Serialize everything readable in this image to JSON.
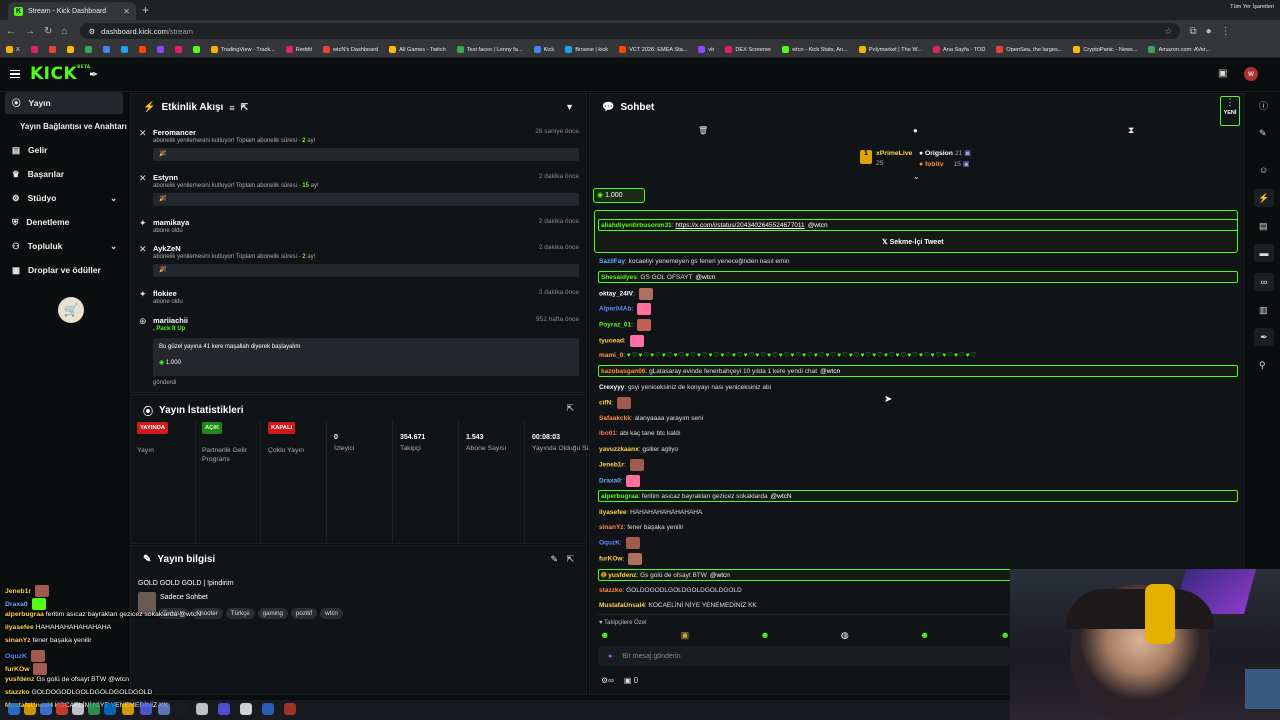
{
  "browser": {
    "tab_title": "Stream - Kick Dashboard",
    "url_host": "dashboard.kick.com",
    "url_path": "/stream",
    "bookmarks": [
      "X",
      "",
      "",
      "",
      "",
      "",
      "",
      "",
      "",
      "",
      "",
      "TradingView - Track...",
      "Reddit",
      "wtcN's Dashboard",
      "All Games - Twitch",
      "Text faces | Lenny fa...",
      "Kick",
      "Browse | kick",
      "VCT 2026: EMEA Sta...",
      "vlr",
      "DEX Screener",
      "wtcn - Kick Stats, An...",
      "Polymarket | The W...",
      "Ana Sayfa - TOD",
      "OpenSea, the larges...",
      "CryptoPanic - News...",
      "Amazon.com: AVer..."
    ],
    "bookmarks_all": "Tüm Yer İşaretleri"
  },
  "sidebar": {
    "items": [
      {
        "label": "Yayın"
      },
      {
        "label": "Yayın Bağlantısı ve Anahtarı"
      },
      {
        "label": "Gelir"
      },
      {
        "label": "Başarılar"
      },
      {
        "label": "Stüdyo"
      },
      {
        "label": "Denetleme"
      },
      {
        "label": "Topluluk"
      },
      {
        "label": "Droplar ve ödüller"
      }
    ]
  },
  "activity": {
    "title": "Etkinlik Akışı",
    "items": [
      {
        "name": "Feromancer",
        "time": "28 saniye önce",
        "desc_a": "abonelik yenilemesini kutluyor! Toplam abonelik süresi - ",
        "desc_b": "2",
        "desc_c": " ay!"
      },
      {
        "name": "Estynn",
        "time": "2 dakika önce",
        "desc_a": "abonelik yenilemesini kutluyor! Toplam abonelik süresi - ",
        "desc_b": "15",
        "desc_c": " ay!"
      },
      {
        "name": "mamikaya",
        "time": "2 dakika önce",
        "desc": "abone oldu"
      },
      {
        "name": "AykZeN",
        "time": "2 dakika önce",
        "desc_a": "abonelik yenilemesini kutluyor! Toplam abonelik süresi - ",
        "desc_b": "2",
        "desc_c": " ay!"
      },
      {
        "name": "flokiee",
        "time": "3 dakika önce",
        "desc": "abone oldu"
      },
      {
        "name": "mariiachii",
        "time": "952 hafta önce",
        "pack": ", Pack It Up",
        "msg": "Bu güzel yayına 41 kere maşallah diyerek başlayalım",
        "amount": "1.000",
        "sent": "gönderdi"
      }
    ]
  },
  "stats": {
    "title": "Yayın İstatistikleri",
    "cols": [
      {
        "badge": "YAYINDA",
        "label": "Yayın"
      },
      {
        "badge": "AÇIK",
        "label": "Partnerlik Gelir Programı"
      },
      {
        "badge": "KAPALI",
        "label": "Çoklu Yayın"
      },
      {
        "value": "0",
        "label": "İzleyici"
      },
      {
        "value": "354.671",
        "label": "Takipçi"
      },
      {
        "value": "1.543",
        "label": "Abone Sayısı"
      },
      {
        "value": "00:08:03",
        "label": "Yayında Olduğu Süre"
      }
    ]
  },
  "info": {
    "title": "Yayın bilgisi",
    "stream_title": "GOLD GOLD GOLD | !pindirim",
    "chat_mode": "Sadece Sohbet",
    "tags": [
      "Turkish",
      "Shooter",
      "Türkçe",
      "gaming",
      "pozitif",
      "wtcn"
    ]
  },
  "chat": {
    "title": "Sohbet",
    "new_label": "YENİ",
    "leader1": {
      "name": "xPrimeLive",
      "count": "25"
    },
    "leader2": {
      "name": "Origsion",
      "count": "21"
    },
    "leader3": {
      "name": "fobitv",
      "count": "15"
    },
    "kicks": "1.000",
    "tweet_label": "Sekme-İçi Tweet",
    "messages": [
      {
        "user": "aliahdiyentirbusonm31",
        "text": "https://x.com/i/status/2043402645524677011",
        "mention": "@wtcn",
        "color": "#53fc18"
      },
      {
        "user": "SazilFay",
        "text": "kocaeliyi yenemeyen gs feneri yeneceğinden nasıl emin",
        "color": "#6ea8ff"
      },
      {
        "user": "Shesaidyes",
        "text": "GS GOL OFSAYT",
        "mention": "@wtcn",
        "color": "#53fc18"
      },
      {
        "user": "oktay_24IV",
        "text": "",
        "color": "#ffffff"
      },
      {
        "user": "Alper04Ab",
        "text": "",
        "color": "#5b8cff"
      },
      {
        "user": "Poyraz_01",
        "text": "",
        "color": "#53fc18"
      },
      {
        "user": "tyuoead",
        "text": "",
        "color": "#ffd24a"
      },
      {
        "user": "mami_0",
        "text": "",
        "color": "#ff9b3b"
      },
      {
        "user": "kazobasgan06",
        "text": "gLatasaray evinde fenerbahçeyi 10 yılda 1 kere yendi chat",
        "mention": "@wtcn",
        "color": "#ff8a3b"
      },
      {
        "user": "Crexyyy",
        "text": "gsyi yeniceksiniz de konyayı nası yeniceksiniz abi",
        "color": "#ffffff"
      },
      {
        "user": "cifN",
        "text": "",
        "color": "#ffd24a"
      },
      {
        "user": "Safaakckk",
        "text": "alanyaaaa yarayım seni",
        "color": "#ff8a3b"
      },
      {
        "user": "ibo01",
        "text": "abi kaç tane btc kaldı",
        "color": "#ff6b6b"
      },
      {
        "user": "yavuzzkaanx",
        "text": "gsliler agliyo",
        "color": "#ffd24a"
      },
      {
        "user": "Jeneb1r",
        "text": "",
        "color": "#ffd24a"
      },
      {
        "user": "Draxa0",
        "text": "",
        "color": "#6ea8ff"
      },
      {
        "user": "alperbugraa",
        "text": "feritim asıcaz bayrakları gezicez sokaklarda",
        "mention": "@wtcN",
        "color": "#53fc18"
      },
      {
        "user": "ilyasefee",
        "text": "HAHAHAHAHAHAHAHA",
        "color": "#ffd24a"
      },
      {
        "user": "sinanYz",
        "text": "fener başaka yenilir",
        "color": "#ff8a3b"
      },
      {
        "user": "OquzK",
        "text": "",
        "color": "#5b8cff"
      },
      {
        "user": "furKOw",
        "text": "",
        "color": "#ffd24a"
      },
      {
        "user": "yusfdenz",
        "text": "Gs golü de ofsayt BTW",
        "mention": "@wtcn",
        "color": "#ffd24a"
      },
      {
        "user": "stazzko",
        "text": "GOLDOGODLGOLDGOLDGOLDGOLD",
        "color": "#ff8a3b"
      },
      {
        "user": "MustafaUnsal4",
        "text": "KOCAELİNİ NİYE YENEMEDİNİZ KK",
        "color": "#ffd24a"
      }
    ],
    "followers_only": "Takipçilere Özel",
    "input_placeholder": "Bir mesaj gönderin",
    "bottom_count": "0"
  },
  "overlay": [
    {
      "user": "Jeneb1r",
      "text": "",
      "color": "#ffd24a"
    },
    {
      "user": "Draxa0",
      "text": "",
      "color": "#6ea8ff"
    },
    {
      "user": "alperbugraa",
      "text": "feritim asıcaz bayrakları gezicez sokaklarda @wtcN",
      "color": "#ffd24a"
    },
    {
      "user": "ilyasefee",
      "text": "HAHAHAHAHAHAHAHA",
      "color": "#ffd24a"
    },
    {
      "user": "sinanYz",
      "text": "fener başaka yenilir",
      "color": "#ffd24a"
    },
    {
      "user": "OquzK",
      "text": "",
      "color": "#5b8cff"
    },
    {
      "user": "furKOw",
      "text": "",
      "color": "#ffd24a"
    },
    {
      "user": "yusfdenz",
      "text": "Gs golü de ofsayt BTW @wtcn",
      "color": "#ffd24a"
    },
    {
      "user": "stazzko",
      "text": "GOLDOGODLGOLDGOLDGOLDGOLD",
      "color": "#ffd24a"
    },
    {
      "user": "MustafaUnsal4",
      "text": "KOCAELİNİ NİYE YENEMEDİNİZ KK",
      "color": "#ffd24a"
    }
  ],
  "colors": {
    "accent": "#53fc18",
    "live": "#d31a1a",
    "panel": "#111417",
    "bg": "#0b0e0f"
  }
}
